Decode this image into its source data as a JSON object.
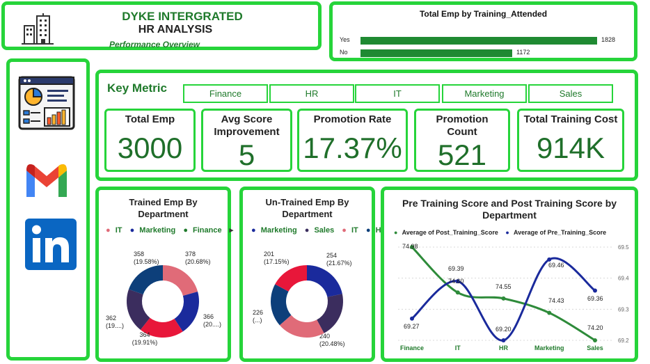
{
  "header": {
    "company": "DYKE INTERGRATED",
    "title": "HR ANALYSIS",
    "subtitle": "Performance Overview"
  },
  "training_attended_chart": {
    "title": "Total Emp by Training_Attended",
    "rows": [
      {
        "label": "Yes",
        "value": 1828,
        "value_text": "1828"
      },
      {
        "label": "No",
        "value": 1172,
        "value_text": "1172"
      }
    ]
  },
  "sidebar": {
    "icons": [
      "dashboard-icon",
      "gmail-icon",
      "linkedin-icon"
    ]
  },
  "key_metric": {
    "title": "Key Metric",
    "slicers": [
      "Finance",
      "HR",
      "IT",
      "Marketing",
      "Sales"
    ],
    "kpis": [
      {
        "label": "Total Emp",
        "value": "3000"
      },
      {
        "label": "Avg Score Improvement",
        "value": "5"
      },
      {
        "label": "Promotion Rate",
        "value": "17.37%"
      },
      {
        "label": "Promotion Count",
        "value": "521"
      },
      {
        "label": "Total Training Cost",
        "value": "914K"
      }
    ]
  },
  "trained_chart": {
    "title": "Trained Emp By Department",
    "legend": [
      {
        "name": "IT",
        "color": "#e06b78"
      },
      {
        "name": "Marketing",
        "color": "#1a2a9c"
      },
      {
        "name": "Finance",
        "color": "#1f7a2b"
      }
    ],
    "labels": [
      "378 (20.68%)",
      "366 (20....)",
      "364 (19.91%)",
      "362 (19....)",
      "358 (19.58%)"
    ]
  },
  "untrained_chart": {
    "title": "Un-Trained Emp By Department",
    "legend": [
      {
        "name": "Marketing",
        "color": "#1a2a9c"
      },
      {
        "name": "Sales",
        "color": "#3b2d5e"
      },
      {
        "name": "IT",
        "color": "#e06b78"
      },
      {
        "name": "HR",
        "color": "#0d3f7a"
      }
    ],
    "labels": [
      "254 (21.67%)",
      "240 (20.48%)",
      "226 (...)",
      "201 (17.15%)"
    ]
  },
  "chart_data": [
    {
      "type": "bar",
      "title": "Total Emp by Training_Attended",
      "categories": [
        "Yes",
        "No"
      ],
      "values": [
        1828,
        1172
      ],
      "orientation": "horizontal",
      "color": "#1f8a32"
    },
    {
      "type": "pie",
      "title": "Trained Emp By Department",
      "slices": [
        {
          "value": 378,
          "label": "378 (20.68%)",
          "color": "#e06b78"
        },
        {
          "value": 366,
          "label": "366 (20....)",
          "color": "#1a2a9c"
        },
        {
          "value": 364,
          "label": "364 (19.91%)",
          "color": "#e8173a"
        },
        {
          "value": 362,
          "label": "362 (19....)",
          "color": "#3b2d5e"
        },
        {
          "value": 358,
          "label": "358 (19.58%)",
          "color": "#0d3f7a"
        }
      ]
    },
    {
      "type": "pie",
      "title": "Un-Trained Emp By Department",
      "slices": [
        {
          "value": 254,
          "label": "254 (21.67%)",
          "color": "#1a2a9c"
        },
        {
          "value": 240,
          "label": "240 (20.48%)",
          "color": "#3b2d5e"
        },
        {
          "value": 251,
          "label": "",
          "color": "#e06b78"
        },
        {
          "value": 226,
          "label": "226 (...)",
          "color": "#0d3f7a"
        },
        {
          "value": 201,
          "label": "201 (17.15%)",
          "color": "#e8173a"
        }
      ]
    },
    {
      "type": "line",
      "title": "Pre Training Score and Post Training Score by Department",
      "categories": [
        "Finance",
        "IT",
        "HR",
        "Marketing",
        "Sales"
      ],
      "series": [
        {
          "name": "Average of Post_Training_Score",
          "color": "#2e8b3a",
          "values": [
            74.98,
            74.6,
            74.55,
            74.43,
            74.2
          ],
          "labels": [
            "74.98",
            "74.60",
            "74.55",
            "74.43",
            "74.20"
          ]
        },
        {
          "name": "Average of Pre_Training_Score",
          "color": "#1a2a9c",
          "values": [
            69.27,
            69.39,
            69.2,
            69.46,
            69.36
          ],
          "labels": [
            "69.27",
            "69.39",
            "69.20",
            "69.46",
            "69.36"
          ]
        }
      ],
      "y2_ticks": [
        "69.5",
        "69.4",
        "69.3",
        "69.2"
      ],
      "y2lim": [
        69.2,
        69.5
      ],
      "ylim": [
        74.2,
        74.98
      ]
    }
  ]
}
